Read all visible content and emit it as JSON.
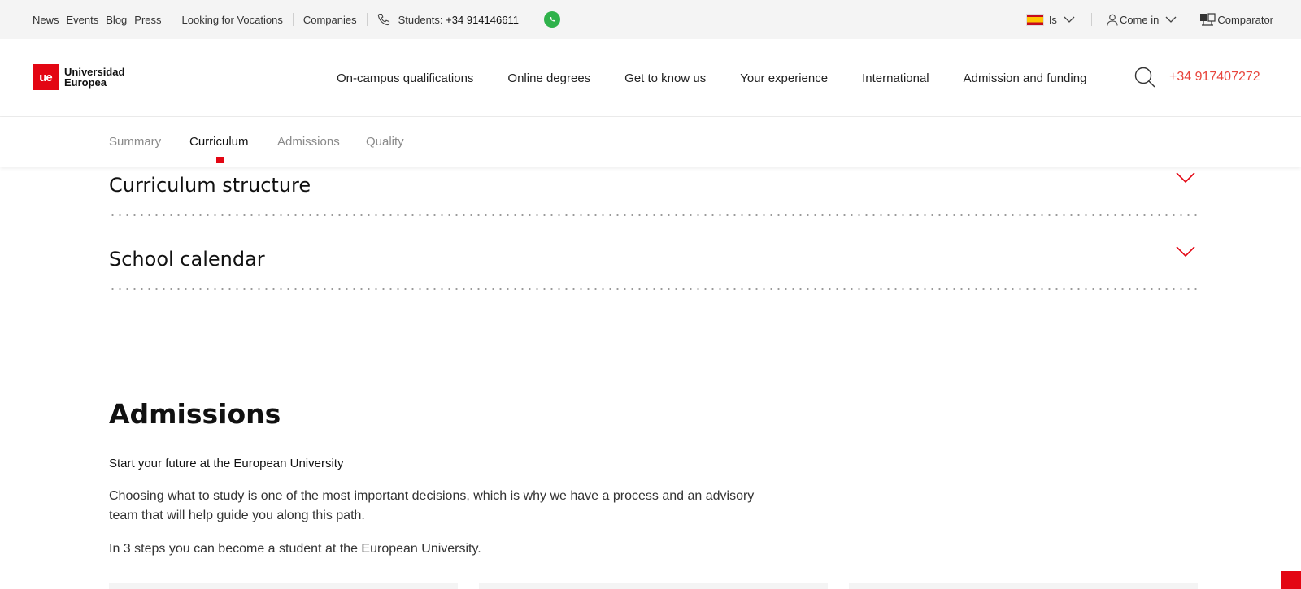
{
  "topbar": {
    "links": [
      "News",
      "Events",
      "Blog",
      "Press"
    ],
    "vocations": "Looking for Vocations",
    "companies": "Companies",
    "students_label": "Students:",
    "students_phone": "+34 914146611",
    "language": "Is",
    "login": "Come in",
    "comparator": "Comparator"
  },
  "header": {
    "logo_mark": "ue",
    "logo_line1": "Universidad",
    "logo_line2": "Europea",
    "nav": [
      "On-campus qualifications",
      "Online degrees",
      "Get to know us",
      "Your experience",
      "International",
      "Admission and funding"
    ],
    "phone": "+34 917407272"
  },
  "tabs": {
    "items": [
      "Summary",
      "Curriculum",
      "Admissions",
      "Quality"
    ],
    "active": "Curriculum"
  },
  "accordions": [
    "Curriculum structure",
    "School calendar"
  ],
  "admissions": {
    "title": "Admissions",
    "subtitle": "Start your future at the European University",
    "paragraph1": "Choosing what to study is one of the most important decisions, which is why we have a process and an advisory team that will help guide you along this path.",
    "paragraph2": "In 3 steps you can become a student at the European University."
  },
  "colors": {
    "brand_red": "#e30613",
    "phone_red": "#e8453c",
    "whatsapp_green": "#2fb24b"
  },
  "icons": [
    "phone-icon",
    "whatsapp-icon",
    "spain-flag-icon",
    "chevron-down-icon",
    "user-icon",
    "comparator-icon",
    "search-icon"
  ]
}
